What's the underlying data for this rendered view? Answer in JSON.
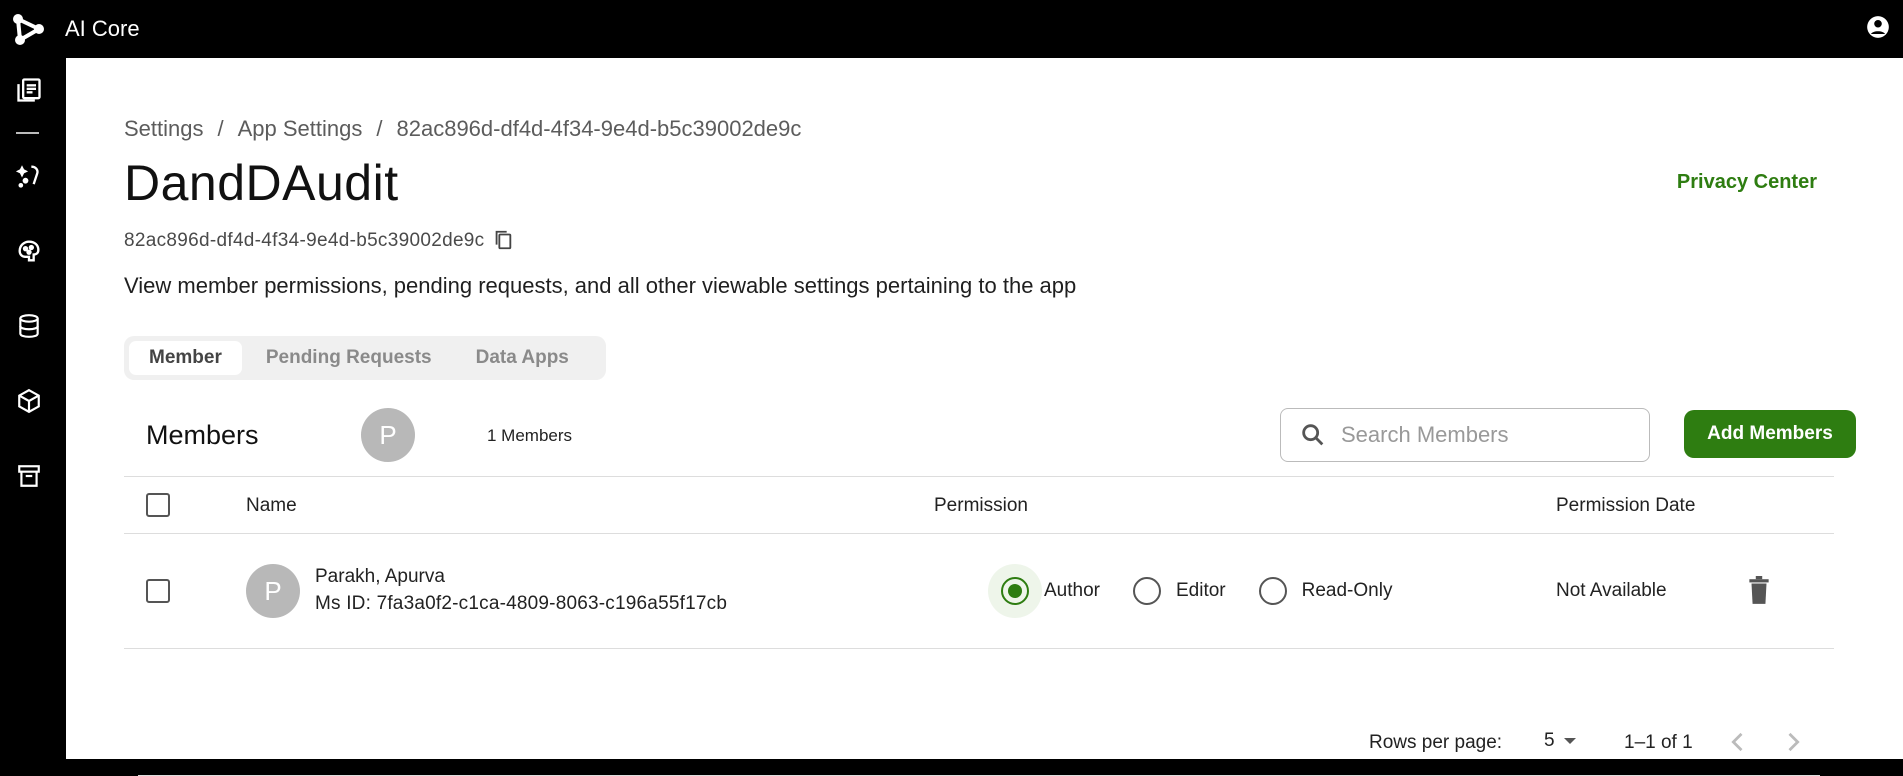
{
  "app": {
    "title": "AI Core"
  },
  "sidebar": {
    "items": [
      {
        "icon": "catalog-icon"
      },
      {
        "icon": "prompt-icon"
      },
      {
        "icon": "model-brain-icon"
      },
      {
        "icon": "database-icon"
      },
      {
        "icon": "package-cube-icon"
      },
      {
        "icon": "archive-icon"
      }
    ]
  },
  "breadcrumb": {
    "items": [
      "Settings",
      "App Settings",
      "82ac896d-df4d-4f34-9e4d-b5c39002de9c"
    ],
    "separator": "/"
  },
  "page": {
    "title": "DandDAudit",
    "app_id": "82ac896d-df4d-4f34-9e4d-b5c39002de9c",
    "description": "View member permissions, pending requests, and all other viewable settings pertaining to the app",
    "privacy_link": "Privacy Center"
  },
  "tabs": [
    {
      "label": "Member",
      "active": true
    },
    {
      "label": "Pending Requests",
      "active": false
    },
    {
      "label": "Data Apps",
      "active": false
    }
  ],
  "members": {
    "title": "Members",
    "avatar_initial": "P",
    "count_label": "1 Members",
    "search_placeholder": "Search Members",
    "add_button": "Add Members"
  },
  "table": {
    "columns": [
      "Name",
      "Permission",
      "Permission Date"
    ],
    "rows": [
      {
        "initial": "P",
        "name": "Parakh, Apurva",
        "ms_id": "Ms ID: 7fa3a0f2-c1ca-4809-8063-c196a55f17cb",
        "permission_options": [
          "Author",
          "Editor",
          "Read-Only"
        ],
        "selected_permission": "Author",
        "permission_date": "Not Available"
      }
    ]
  },
  "pagination": {
    "rows_per_page_label": "Rows per page:",
    "rows_per_page": "5",
    "range": "1–1 of 1"
  },
  "colors": {
    "accent": "#2e7d11",
    "topbar": "#000000",
    "avatar": "#b8b8b8"
  }
}
